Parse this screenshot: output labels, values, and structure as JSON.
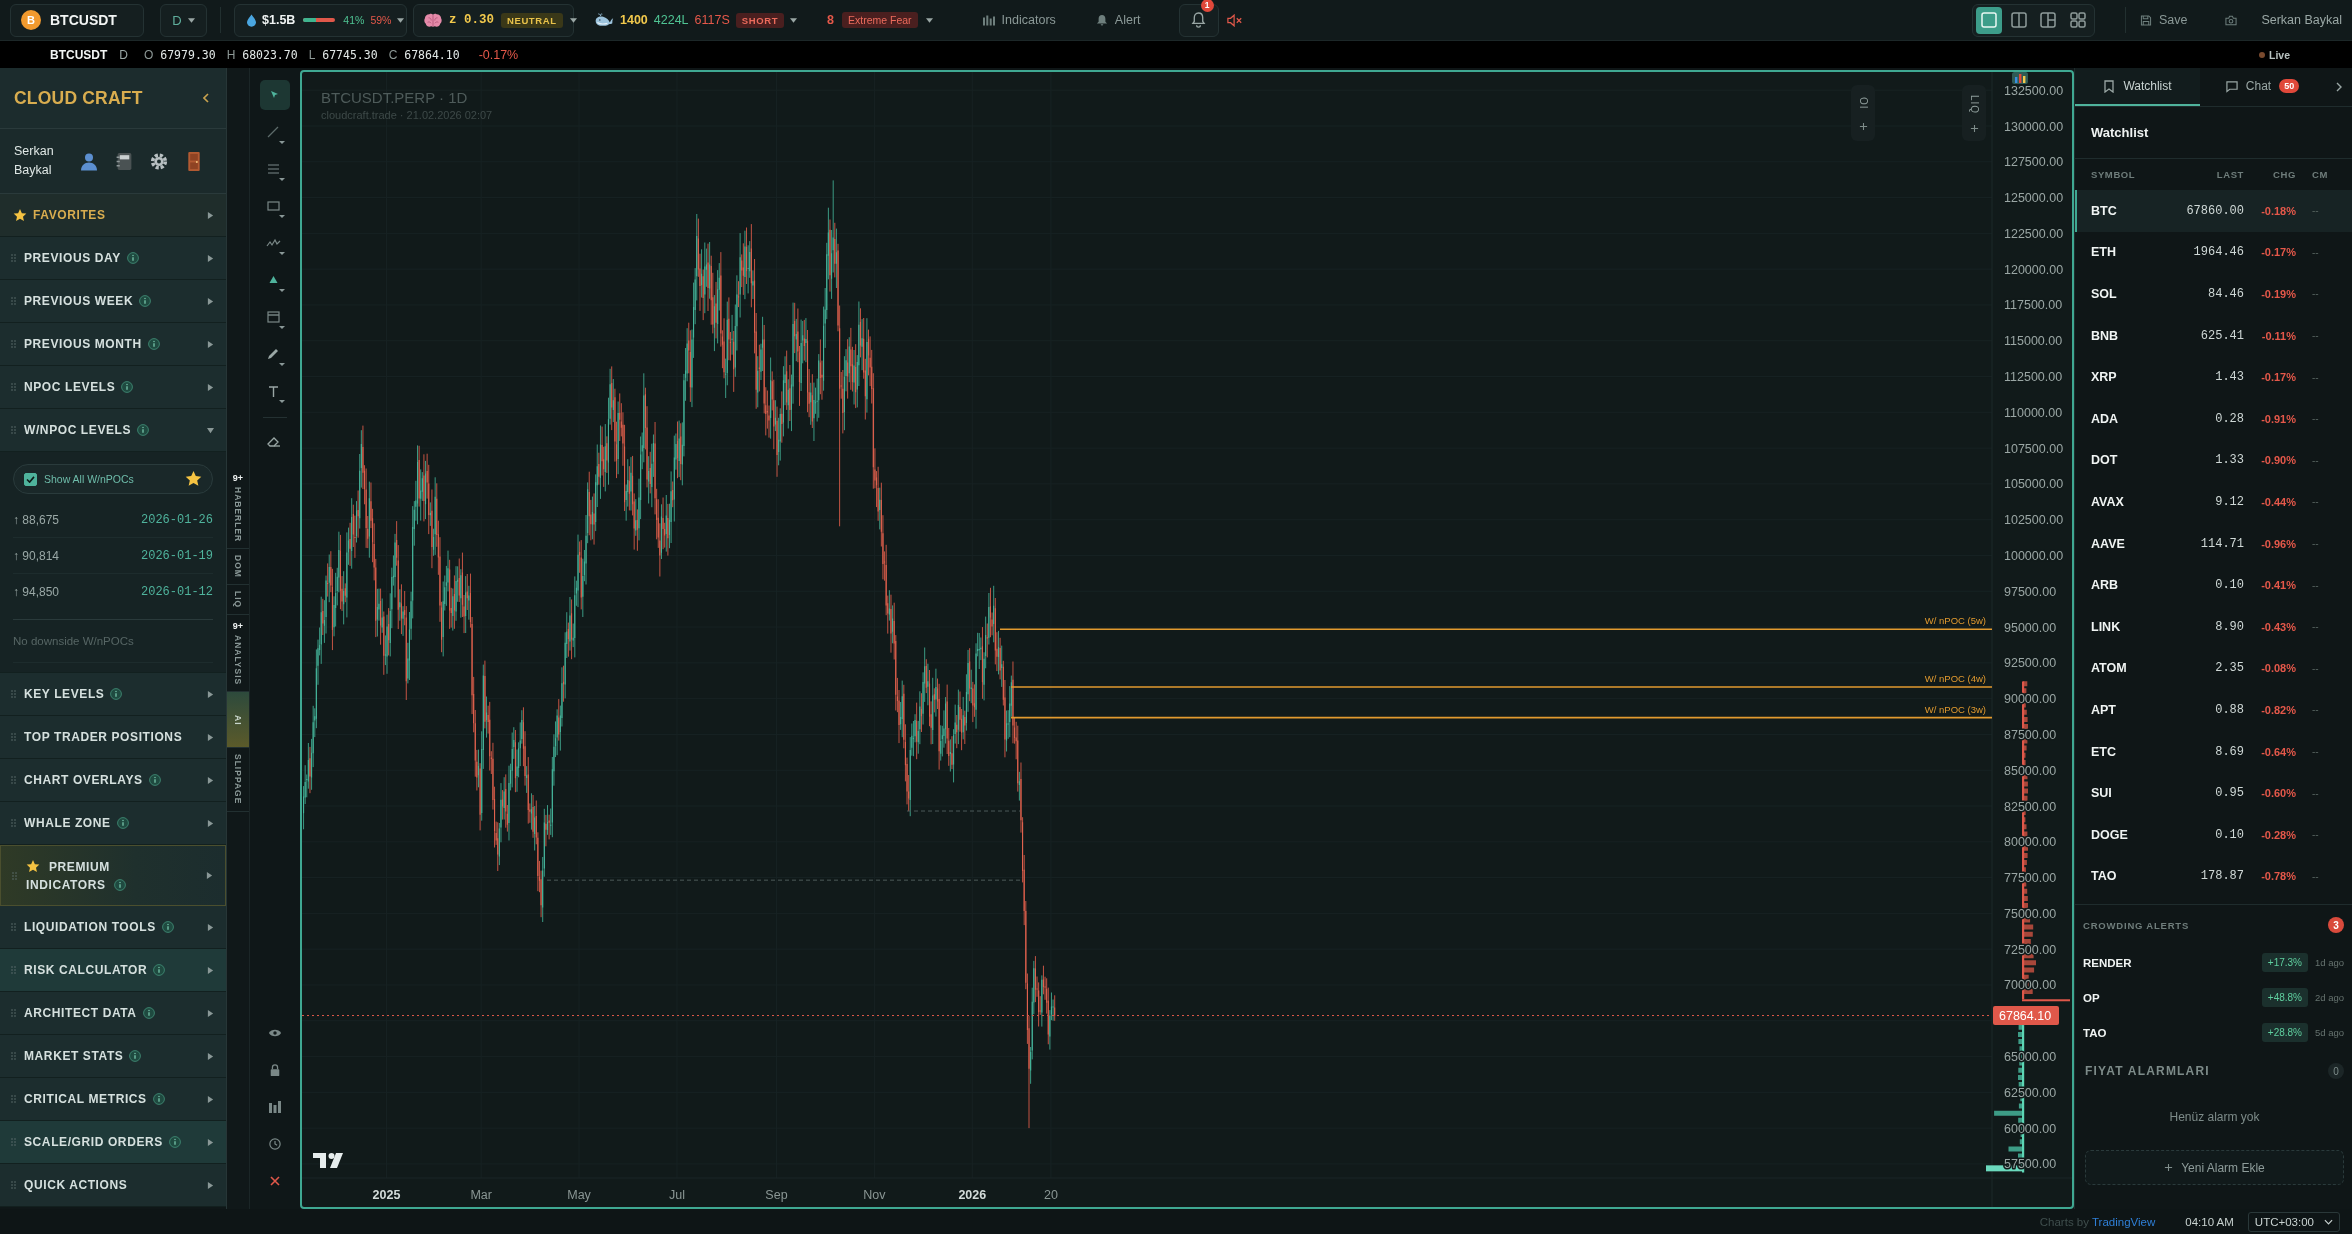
{
  "top_bar": {
    "symbol": {
      "coin": "B",
      "label": "BTCUSDT"
    },
    "interval": "D",
    "liquidity": {
      "value": "$1.5B",
      "level": 0.41,
      "long": "41%",
      "short": "59%"
    },
    "sentiment": {
      "value": "z 0.30",
      "badge": "NEUTRAL"
    },
    "whales": {
      "value": "1400",
      "longs": "4224L",
      "shorts": "6117S",
      "badge": "SHORT"
    },
    "fear_greed": {
      "value": "8",
      "badge": "Extreme Fear"
    },
    "indicators": "Indicators",
    "alert": "Alert",
    "notifications": "1",
    "muted": true,
    "layouts": [
      {
        "kind": "single",
        "selected": true
      },
      {
        "kind": "columns",
        "selected": false
      },
      {
        "kind": "split",
        "selected": false
      },
      {
        "kind": "grid",
        "selected": false
      }
    ],
    "save": "Save",
    "user": "Serkan Baykal"
  },
  "info_bar": {
    "symbol": "BTCUSDT",
    "interval": "D",
    "ohlc": [
      {
        "key": "O",
        "value": "67979.30"
      },
      {
        "key": "H",
        "value": "68023.70"
      },
      {
        "key": "L",
        "value": "67745.30"
      },
      {
        "key": "C",
        "value": "67864.10"
      }
    ],
    "change": "-0.17%",
    "status": "Live"
  },
  "sidebar": {
    "brand": "CLOUD CRAFT",
    "user": "Serkan Baykal",
    "sections": [
      {
        "kind": "favorites",
        "label": "FAVORITES",
        "info": false,
        "expanded": false,
        "highlighted": false
      },
      {
        "kind": "section",
        "label": "PREVIOUS DAY",
        "info": true,
        "expanded": false,
        "highlighted": false
      },
      {
        "kind": "section",
        "label": "PREVIOUS WEEK",
        "info": true,
        "expanded": false,
        "highlighted": false
      },
      {
        "kind": "section",
        "label": "PREVIOUS MONTH",
        "info": true,
        "expanded": false,
        "highlighted": false
      },
      {
        "kind": "section",
        "label": "NPOC LEVELS",
        "info": true,
        "expanded": false,
        "highlighted": false
      },
      {
        "kind": "section",
        "label": "W/NPOC LEVELS",
        "info": true,
        "expanded": true,
        "highlighted": false,
        "content": {
          "toggle": {
            "label": "Show All W/nPOCs",
            "checked": true
          },
          "levels": [
            {
              "price": "↑ 88,675",
              "date": "2026-01-26"
            },
            {
              "price": "↑ 90,814",
              "date": "2026-01-19"
            },
            {
              "price": "↑ 94,850",
              "date": "2026-01-12"
            }
          ],
          "note": "No downside W/nPOCs"
        }
      },
      {
        "kind": "section",
        "label": "KEY LEVELS",
        "info": true,
        "expanded": false,
        "highlighted": false
      },
      {
        "kind": "section",
        "label": "TOP TRADER POSITIONS",
        "info": false,
        "expanded": false,
        "highlighted": false
      },
      {
        "kind": "section",
        "label": "CHART OVERLAYS",
        "info": true,
        "expanded": false,
        "highlighted": false
      },
      {
        "kind": "section",
        "label": "WHALE ZONE",
        "info": true,
        "expanded": false,
        "highlighted": false
      },
      {
        "kind": "premium",
        "label": "PREMIUM INDICATORS",
        "info": true,
        "expanded": false,
        "highlighted": true
      },
      {
        "kind": "section",
        "label": "LIQUIDATION TOOLS",
        "info": true,
        "expanded": false,
        "highlighted": false
      },
      {
        "kind": "section",
        "label": "RISK CALCULATOR",
        "info": true,
        "expanded": false,
        "highlighted": true
      },
      {
        "kind": "section",
        "label": "ARCHITECT DATA",
        "info": true,
        "expanded": false,
        "highlighted": false
      },
      {
        "kind": "section",
        "label": "MARKET STATS",
        "info": true,
        "expanded": false,
        "highlighted": false
      },
      {
        "kind": "section",
        "label": "CRITICAL METRICS",
        "info": true,
        "expanded": false,
        "highlighted": false
      },
      {
        "kind": "section",
        "label": "SCALE/GRID ORDERS",
        "info": true,
        "expanded": false,
        "highlighted": true
      },
      {
        "kind": "section",
        "label": "QUICK ACTIONS",
        "info": false,
        "expanded": false,
        "highlighted": false
      }
    ]
  },
  "side_tabs": [
    {
      "label": "HABERLER",
      "badge": "9+",
      "selected": false
    },
    {
      "label": "DOM",
      "selected": false
    },
    {
      "label": "LIQ",
      "selected": false
    },
    {
      "label": "ANALYSIS",
      "badge": "9+",
      "selected": false
    },
    {
      "label": "AI",
      "selected": true
    },
    {
      "label": "SLIPPAGE",
      "selected": false
    }
  ],
  "drawing_tools": [
    {
      "kind": "cursor",
      "selected": true
    },
    {
      "kind": "line",
      "selected": false
    },
    {
      "kind": "levels",
      "selected": false
    },
    {
      "kind": "rectangle",
      "selected": false
    },
    {
      "kind": "pattern",
      "selected": false
    },
    {
      "kind": "shape",
      "selected": false
    },
    {
      "kind": "range",
      "selected": false
    },
    {
      "kind": "brush",
      "selected": false
    },
    {
      "kind": "text",
      "selected": false
    },
    {
      "kind": "eraser",
      "selected": false
    }
  ],
  "chart": {
    "title": "BTCUSDT.PERP · 1D",
    "subtitle": "cloudcraft.trade · 21.02.2026 02:07",
    "overlay_toggles": [
      {
        "label": "OI"
      },
      {
        "label": "LIQ"
      }
    ],
    "price_labels": [
      "132500.00",
      "130000.00",
      "127500.00",
      "125000.00",
      "122500.00",
      "120000.00",
      "117500.00",
      "115000.00",
      "112500.00",
      "110000.00",
      "107500.00",
      "105000.00",
      "102500.00",
      "100000.00",
      "97500.00",
      "95000.00",
      "92500.00",
      "90000.00",
      "87500.00",
      "85000.00",
      "82500.00",
      "80000.00",
      "77500.00",
      "75000.00",
      "72500.00",
      "70000.00",
      "65000.00",
      "62500.00",
      "60000.00",
      "57500.00"
    ],
    "time_labels": [
      {
        "label": "2025",
        "major": true
      },
      {
        "label": "Mar",
        "major": false
      },
      {
        "label": "May",
        "major": false
      },
      {
        "label": "Jul",
        "major": false
      },
      {
        "label": "Sep",
        "major": false
      },
      {
        "label": "Nov",
        "major": false
      },
      {
        "label": "2026",
        "major": true
      },
      {
        "label": "20",
        "major": false
      }
    ],
    "npoc_lines": [
      {
        "label": "W/ nPOC (5w)"
      },
      {
        "label": "W/ nPOC (4w)"
      },
      {
        "label": "W/ nPOC (3w)"
      }
    ],
    "last_price": "67864.10"
  },
  "right_panel": {
    "tabs": [
      {
        "kind": "bookmark",
        "label": "Watchlist",
        "selected": true
      },
      {
        "kind": "chat",
        "label": "Chat",
        "badge": "50",
        "selected": false
      }
    ],
    "watchlist": {
      "title": "Watchlist",
      "columns": [
        "SYMBOL",
        "LAST",
        "CHG",
        "CM"
      ],
      "rows": [
        {
          "symbol": "BTC",
          "last": "67860.00",
          "chg": "-0.18%",
          "cm": "--",
          "selected": true
        },
        {
          "symbol": "ETH",
          "last": "1964.46",
          "chg": "-0.17%",
          "cm": "--",
          "selected": false
        },
        {
          "symbol": "SOL",
          "last": "84.46",
          "chg": "-0.19%",
          "cm": "--",
          "selected": false
        },
        {
          "symbol": "BNB",
          "last": "625.41",
          "chg": "-0.11%",
          "cm": "--",
          "selected": false
        },
        {
          "symbol": "XRP",
          "last": "1.43",
          "chg": "-0.17%",
          "cm": "--",
          "selected": false
        },
        {
          "symbol": "ADA",
          "last": "0.28",
          "chg": "-0.91%",
          "cm": "--",
          "selected": false
        },
        {
          "symbol": "DOT",
          "last": "1.33",
          "chg": "-0.90%",
          "cm": "--",
          "selected": false
        },
        {
          "symbol": "AVAX",
          "last": "9.12",
          "chg": "-0.44%",
          "cm": "--",
          "selected": false
        },
        {
          "symbol": "AAVE",
          "last": "114.71",
          "chg": "-0.96%",
          "cm": "--",
          "selected": false
        },
        {
          "symbol": "ARB",
          "last": "0.10",
          "chg": "-0.41%",
          "cm": "--",
          "selected": false
        },
        {
          "symbol": "LINK",
          "last": "8.90",
          "chg": "-0.43%",
          "cm": "--",
          "selected": false
        },
        {
          "symbol": "ATOM",
          "last": "2.35",
          "chg": "-0.08%",
          "cm": "--",
          "selected": false
        },
        {
          "symbol": "APT",
          "last": "0.88",
          "chg": "-0.82%",
          "cm": "--",
          "selected": false
        },
        {
          "symbol": "ETC",
          "last": "8.69",
          "chg": "-0.64%",
          "cm": "--",
          "selected": false
        },
        {
          "symbol": "SUI",
          "last": "0.95",
          "chg": "-0.60%",
          "cm": "--",
          "selected": false
        },
        {
          "symbol": "DOGE",
          "last": "0.10",
          "chg": "-0.28%",
          "cm": "--",
          "selected": false
        },
        {
          "symbol": "TAO",
          "last": "178.87",
          "chg": "-0.78%",
          "cm": "--",
          "selected": false
        }
      ]
    },
    "crowding_alerts": {
      "title": "CROWDING ALERTS",
      "count": "3",
      "items": [
        {
          "symbol": "RENDER",
          "change": "+17.3%",
          "age": "1d ago"
        },
        {
          "symbol": "OP",
          "change": "+48.8%",
          "age": "2d ago"
        },
        {
          "symbol": "TAO",
          "change": "+28.8%",
          "age": "5d ago"
        }
      ]
    },
    "price_alarms": {
      "title": "FIYAT ALARMLARI",
      "count": "0",
      "empty": "Henüz alarm yok",
      "add_button": "Yeni Alarm Ekle"
    }
  },
  "status_bar": {
    "credit": "Charts by",
    "link": "TradingView",
    "time": "04:10 AM",
    "timezone": "UTC+03:00"
  }
}
